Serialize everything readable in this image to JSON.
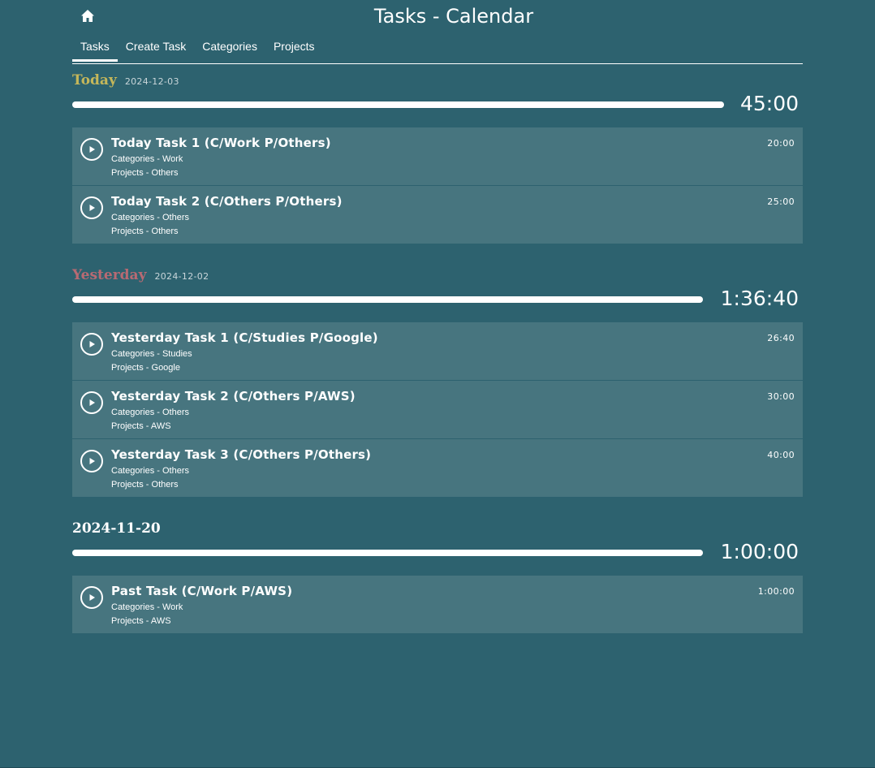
{
  "header": {
    "title": "Tasks - Calendar",
    "home_icon": "home-icon"
  },
  "nav": {
    "tabs": [
      {
        "label": "Tasks",
        "active": true
      },
      {
        "label": "Create Task",
        "active": false
      },
      {
        "label": "Categories",
        "active": false
      },
      {
        "label": "Projects",
        "active": false
      }
    ]
  },
  "colors": {
    "background": "#2d626f",
    "card": "#47757f",
    "today_label": "#c5b75a",
    "yesterday_label": "#b86a73",
    "past_label": "#ffffff"
  },
  "days": [
    {
      "label": "Today",
      "date": "2024-12-03",
      "total": "45:00",
      "progress": 1.0,
      "tasks": [
        {
          "title": "Today Task 1 (C/Work P/Others)",
          "category": "Categories - Work",
          "project": "Projects - Others",
          "duration": "20:00"
        },
        {
          "title": "Today Task 2 (C/Others P/Others)",
          "category": "Categories - Others",
          "project": "Projects - Others",
          "duration": "25:00"
        }
      ]
    },
    {
      "label": "Yesterday",
      "date": "2024-12-02",
      "total": "1:36:40",
      "progress": 1.0,
      "tasks": [
        {
          "title": "Yesterday Task 1 (C/Studies P/Google)",
          "category": "Categories - Studies",
          "project": "Projects - Google",
          "duration": "26:40"
        },
        {
          "title": "Yesterday Task 2 (C/Others P/AWS)",
          "category": "Categories - Others",
          "project": "Projects - AWS",
          "duration": "30:00"
        },
        {
          "title": "Yesterday Task 3 (C/Others P/Others)",
          "category": "Categories - Others",
          "project": "Projects - Others",
          "duration": "40:00"
        }
      ]
    },
    {
      "label": "2024-11-20",
      "date": "",
      "total": "1:00:00",
      "progress": 1.0,
      "tasks": [
        {
          "title": "Past Task (C/Work P/AWS)",
          "category": "Categories - Work",
          "project": "Projects - AWS",
          "duration": "1:00:00"
        }
      ]
    }
  ]
}
